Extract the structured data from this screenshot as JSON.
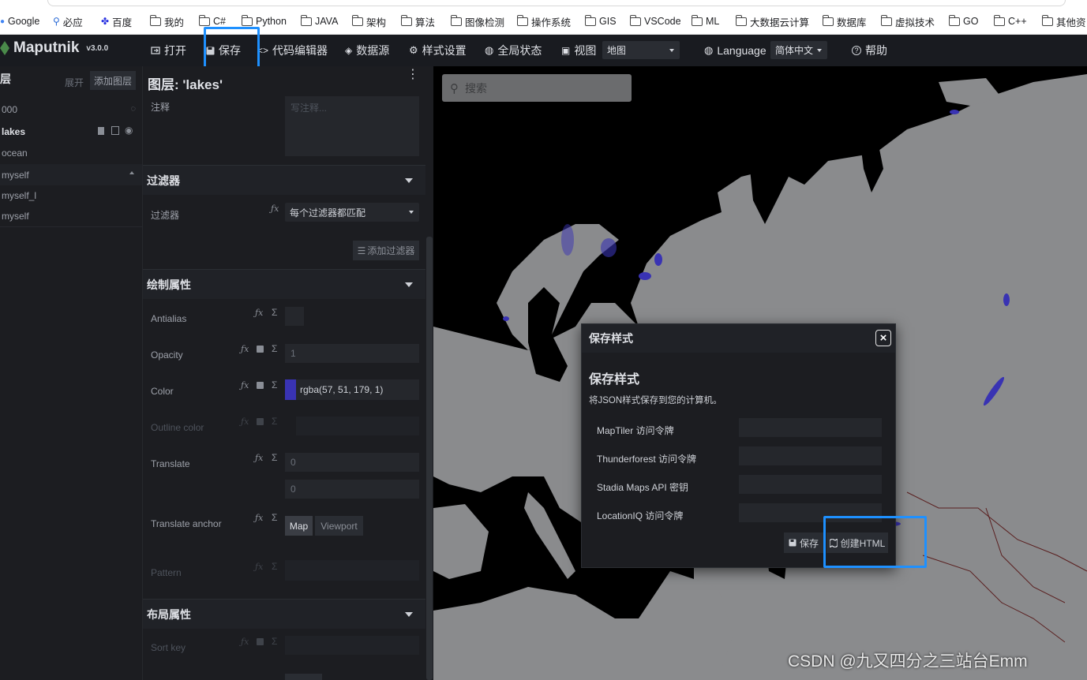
{
  "bookmarks": [
    "Google",
    "必应",
    "百度",
    "我的",
    "C#",
    "Python",
    "JAVA",
    "架构",
    "算法",
    "图像检测",
    "操作系统",
    "GIS",
    "VSCode",
    "ML",
    "大数据云计算",
    "数据库",
    "虚拟技术",
    "GO",
    "C++",
    "其他资"
  ],
  "toolbar": {
    "app_name": "Maputnik",
    "version": "v3.0.0",
    "open": "打开",
    "save": "保存",
    "code_editor": "代码编辑器",
    "data_sources": "数据源",
    "style_settings": "样式设置",
    "global_state": "全局状态",
    "view": "视图",
    "view_value": "地图",
    "language": "Language",
    "language_value": "简体中文",
    "help": "帮助"
  },
  "layers": {
    "title": "层",
    "expand": "展开",
    "add_layer": "添加图层",
    "items": [
      "000",
      "lakes",
      "ocean",
      "myself",
      "myself_l",
      "myself"
    ]
  },
  "editor": {
    "title": "图层: 'lakes'",
    "comment_label": "注释",
    "comment_placeholder": "写注释...",
    "filter_section": "过滤器",
    "filter_label": "过滤器",
    "filter_value": "每个过滤器都匹配",
    "add_filter": "添加过滤器",
    "paint_section": "绘制属性",
    "props": {
      "antialias": "Antialias",
      "opacity": "Opacity",
      "opacity_value": "1",
      "color": "Color",
      "color_value": "rgba(57, 51, 179, 1)",
      "outline_color": "Outline color",
      "translate": "Translate",
      "translate_x": "0",
      "translate_y": "0",
      "translate_anchor": "Translate anchor",
      "anchor_map": "Map",
      "anchor_viewport": "Viewport",
      "pattern": "Pattern"
    },
    "layout_section": "布局属性",
    "sort_key": "Sort key"
  },
  "map": {
    "search_placeholder": "搜索",
    "colors": {
      "land": "#8a8b8d",
      "water": "#000000",
      "lakes": "#3933b3"
    }
  },
  "modal": {
    "header": "保存样式",
    "title": "保存样式",
    "description": "将JSON样式保存到您的计算机。",
    "fields": [
      "MapTiler 访问令牌",
      "Thunderforest 访问令牌",
      "Stadia Maps API 密钥",
      "LocationIQ 访问令牌"
    ],
    "save_button": "保存",
    "create_html_button": "创建HTML"
  },
  "watermark": "CSDN @九又四分之三站台Emm"
}
